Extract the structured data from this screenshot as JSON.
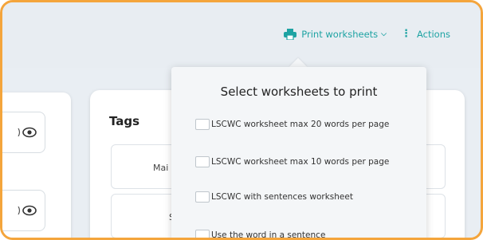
{
  "toolbar": {
    "print_label": "Print worksheets",
    "actions_label": "Actions",
    "accent_color": "#1ea3a3"
  },
  "tags_panel": {
    "title": "Tags",
    "rows": [
      "Mai",
      "S"
    ]
  },
  "print_dropdown": {
    "title": "Select worksheets to print",
    "options": [
      "LSCWC worksheet max 20 words per page",
      "LSCWC worksheet max 10 words per page",
      "LSCWC with sentences worksheet",
      "Use the word in a sentence"
    ]
  },
  "icons": [
    "printer-icon",
    "chevron-down-icon",
    "kebab-icon",
    "eye-icon"
  ]
}
